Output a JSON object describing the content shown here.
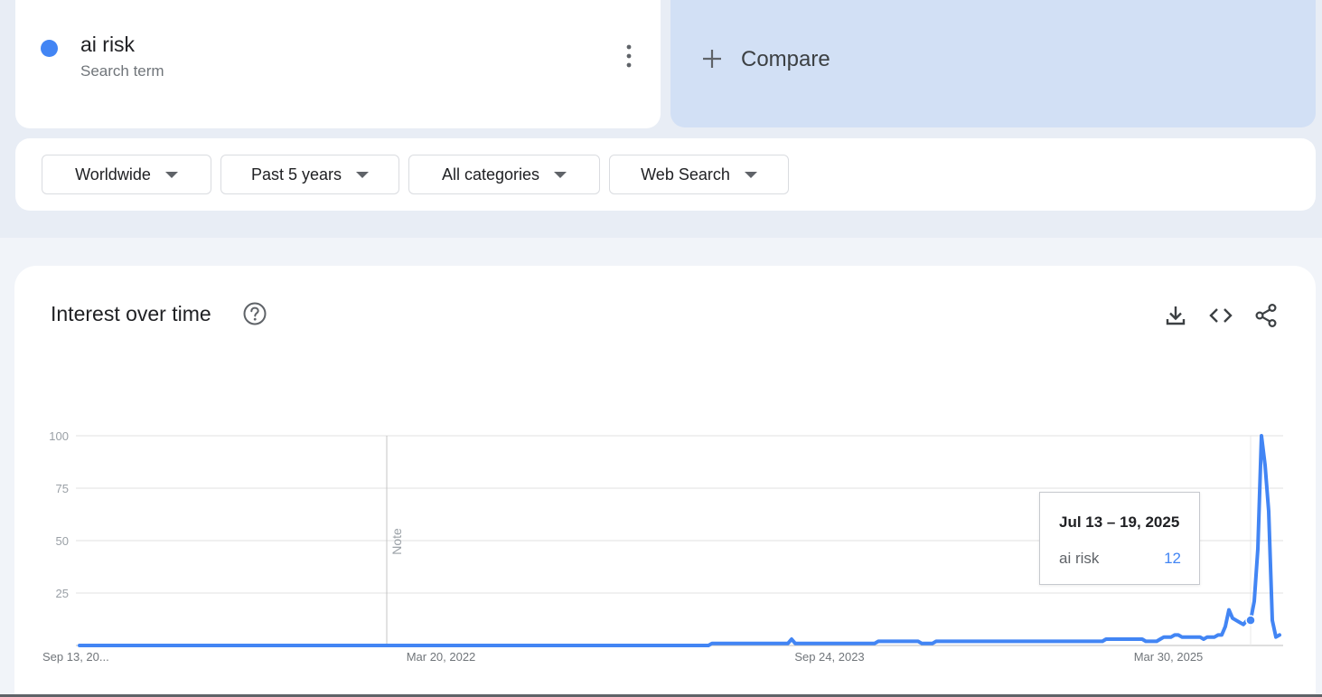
{
  "search_term": {
    "name": "ai risk",
    "subtitle": "Search term",
    "color": "#4285f4",
    "more_icon": "more-vert-icon"
  },
  "compare": {
    "label": "Compare",
    "icon": "plus-icon",
    "background": "#d2e0f5"
  },
  "filters": [
    {
      "label": "Worldwide"
    },
    {
      "label": "Past 5 years"
    },
    {
      "label": "All categories"
    },
    {
      "label": "Web Search"
    }
  ],
  "interest": {
    "title": "Interest over time",
    "help_icon": "help-circle-icon",
    "tools": [
      "download-icon",
      "embed-code-icon",
      "share-icon"
    ]
  },
  "tooltip": {
    "date": "Jul 13 – 19, 2025",
    "term": "ai risk",
    "value": "12"
  },
  "chart_data": {
    "type": "line",
    "ylim": [
      0,
      100
    ],
    "yticks": [
      25,
      50,
      75,
      100
    ],
    "xticks": [
      "Sep 13, 20...",
      "Mar 20, 2022",
      "Sep 24, 2023",
      "Mar 30, 2025"
    ],
    "note_label": "Note",
    "grid": true,
    "series": [
      {
        "name": "ai risk",
        "color": "#4285f4",
        "values": [
          0,
          0,
          0,
          0,
          0,
          0,
          0,
          0,
          0,
          0,
          0,
          0,
          0,
          0,
          0,
          0,
          0,
          0,
          0,
          0,
          0,
          0,
          0,
          0,
          0,
          0,
          0,
          0,
          0,
          0,
          0,
          0,
          0,
          0,
          0,
          0,
          0,
          0,
          0,
          0,
          0,
          0,
          0,
          0,
          0,
          0,
          0,
          0,
          0,
          0,
          0,
          0,
          0,
          0,
          0,
          0,
          0,
          0,
          0,
          0,
          0,
          0,
          0,
          0,
          0,
          0,
          0,
          0,
          0,
          0,
          0,
          0,
          0,
          0,
          0,
          0,
          0,
          0,
          0,
          0,
          0,
          0,
          0,
          0,
          0,
          0,
          0,
          0,
          0,
          0,
          0,
          0,
          0,
          0,
          0,
          0,
          0,
          0,
          0,
          0,
          0,
          0,
          0,
          0,
          0,
          0,
          0,
          0,
          0,
          0,
          0,
          0,
          0,
          0,
          0,
          0,
          0,
          0,
          0,
          0,
          0,
          0,
          0,
          0,
          0,
          0,
          0,
          0,
          0,
          0,
          0,
          0,
          0,
          0,
          0,
          0,
          0,
          0,
          0,
          0,
          0,
          0,
          0,
          0,
          0,
          0,
          0,
          0,
          0,
          0,
          0,
          0,
          0,
          0,
          0,
          0,
          0,
          0,
          0,
          0,
          0,
          0,
          0,
          0,
          0,
          0,
          0,
          0,
          0,
          0,
          0,
          0,
          0,
          0,
          0,
          1,
          1,
          1,
          1,
          1,
          1,
          1,
          1,
          1,
          1,
          1,
          1,
          1,
          1,
          1,
          1,
          1,
          1,
          1,
          1,
          1,
          1,
          3,
          1,
          1,
          1,
          1,
          1,
          1,
          1,
          1,
          1,
          1,
          1,
          1,
          1,
          1,
          1,
          1,
          1,
          1,
          1,
          1,
          1,
          1,
          1,
          2,
          2,
          2,
          2,
          2,
          2,
          2,
          2,
          2,
          2,
          2,
          2,
          1,
          1,
          1,
          1,
          2,
          2,
          2,
          2,
          2,
          2,
          2,
          2,
          2,
          2,
          2,
          2,
          2,
          2,
          2,
          2,
          2,
          2,
          2,
          2,
          2,
          2,
          2,
          2,
          2,
          2,
          2,
          2,
          2,
          2,
          2,
          2,
          2,
          2,
          2,
          2,
          2,
          2,
          2,
          2,
          2,
          2,
          2,
          2,
          2,
          2,
          2,
          3,
          3,
          3,
          3,
          3,
          3,
          3,
          3,
          3,
          3,
          3,
          2,
          2,
          2,
          2,
          3,
          4,
          4,
          4,
          5,
          5,
          4,
          4,
          4,
          4,
          4,
          4,
          3,
          4,
          4,
          4,
          5,
          5,
          9,
          17,
          13,
          12,
          11,
          10,
          12,
          12,
          21,
          46,
          100,
          86,
          64,
          12,
          4,
          5
        ]
      }
    ]
  }
}
